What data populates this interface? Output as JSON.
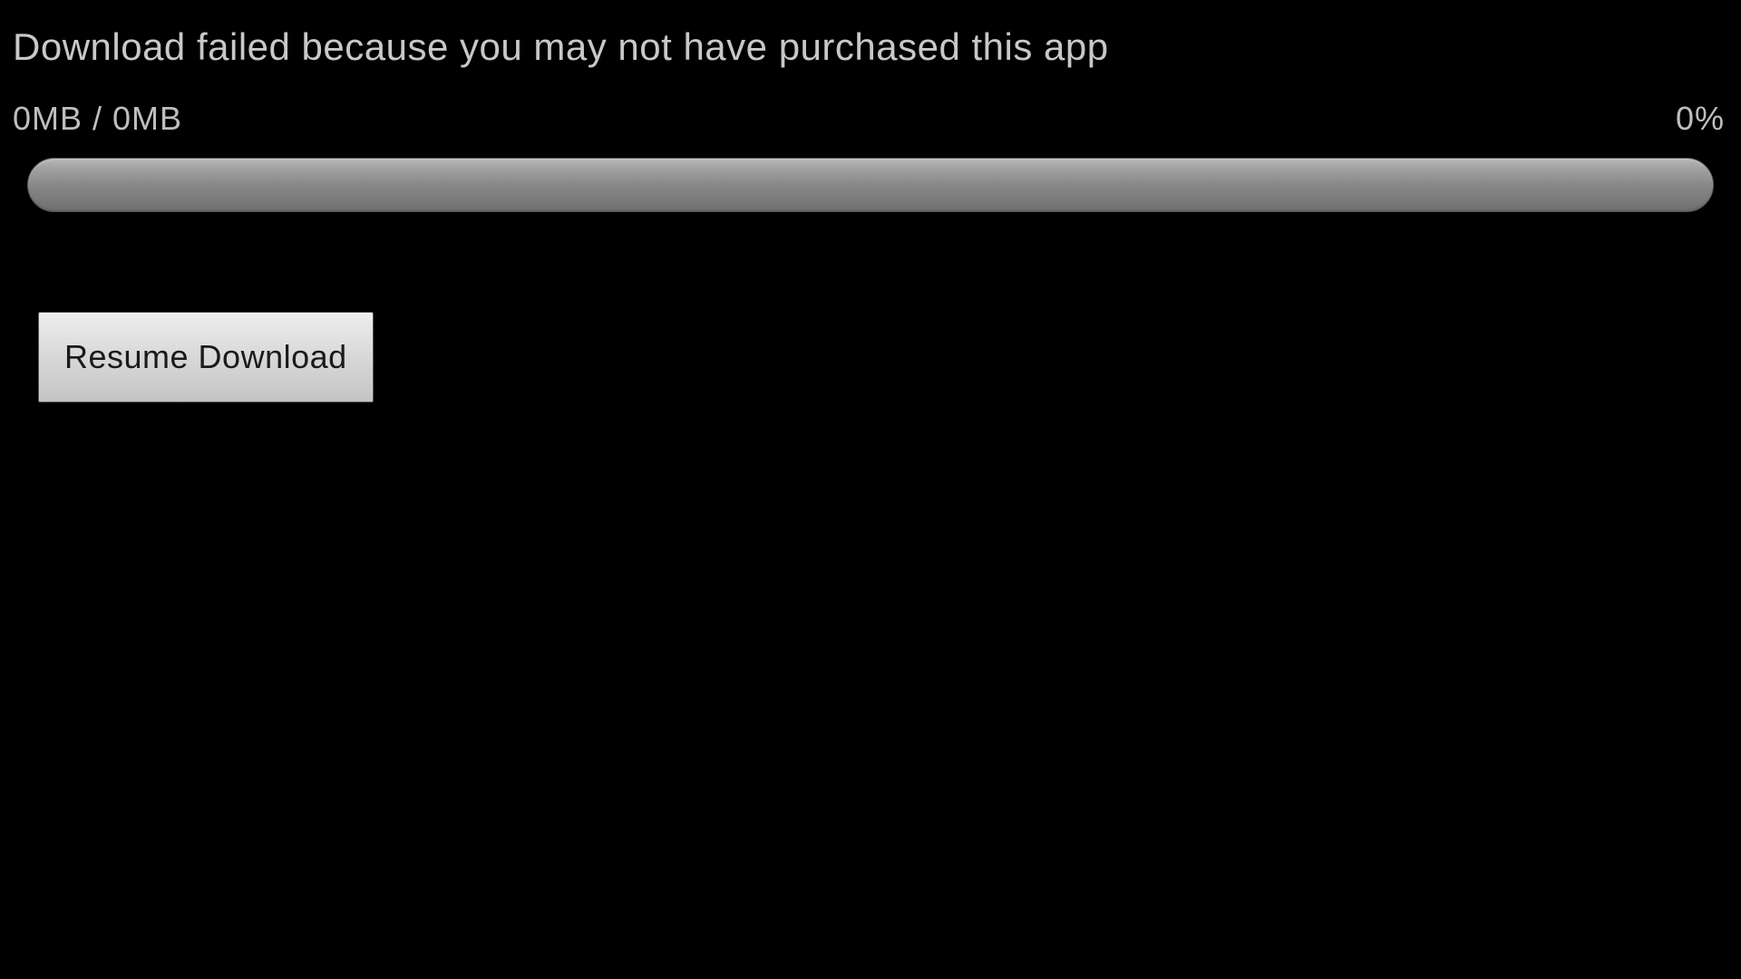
{
  "error_message": "Download failed because you may not have purchased this app",
  "progress": {
    "text": "0MB / 0MB",
    "percent": "0%"
  },
  "actions": {
    "resume_label": "Resume Download"
  }
}
